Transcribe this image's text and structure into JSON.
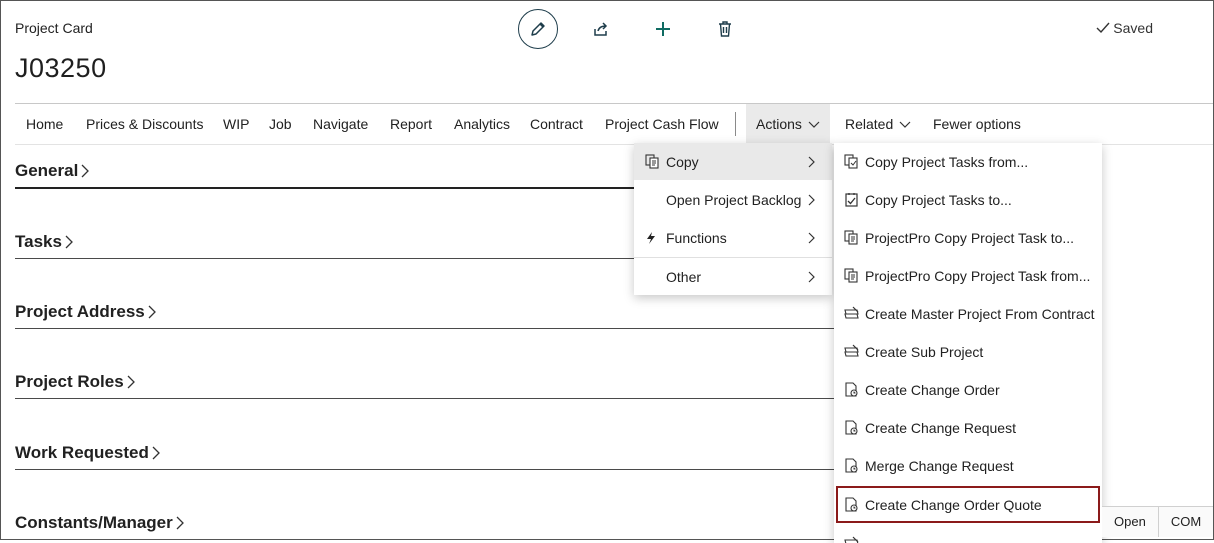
{
  "header": {
    "caption": "Project Card",
    "record_no": "J03250",
    "status": "Saved",
    "icons": [
      "edit-icon",
      "share-icon",
      "add-icon",
      "delete-icon"
    ]
  },
  "actionbar": {
    "items": [
      "Home",
      "Prices & Discounts",
      "WIP",
      "Job",
      "Navigate",
      "Report",
      "Analytics",
      "Contract",
      "Project Cash Flow"
    ],
    "actions_label": "Actions",
    "related_label": "Related",
    "fewer_label": "Fewer options"
  },
  "sections": [
    "General",
    "Tasks",
    "Project Address",
    "Project Roles",
    "Work Requested",
    "Constants/Manager"
  ],
  "actions_menu": {
    "items": [
      {
        "label": "Copy",
        "icon": "copy-icon"
      },
      {
        "label": "Open Project Backlog",
        "icon": ""
      },
      {
        "label": "Functions",
        "icon": "lightning-icon"
      },
      {
        "label": "Other",
        "icon": ""
      }
    ]
  },
  "copy_submenu": {
    "items": [
      {
        "label": "Copy Project Tasks from...",
        "icon": "copy-from-icon"
      },
      {
        "label": "Copy Project Tasks to...",
        "icon": "copy-to-icon"
      },
      {
        "label": "ProjectPro Copy Project Task to...",
        "icon": "copy-icon"
      },
      {
        "label": "ProjectPro Copy Project Task from...",
        "icon": "copy-icon"
      },
      {
        "label": "Create Master Project From Contract",
        "icon": "create-project-icon"
      },
      {
        "label": "Create Sub Project",
        "icon": "create-project-icon"
      },
      {
        "label": "Create Change Order",
        "icon": "document-icon"
      },
      {
        "label": "Create Change Request",
        "icon": "document-icon"
      },
      {
        "label": "Merge Change Request",
        "icon": "document-icon"
      },
      {
        "label": "Create Change Order Quote",
        "icon": "document-icon"
      }
    ]
  },
  "footer_tabs": [
    "Open",
    "COM"
  ],
  "colors": {
    "focus_outline": "#8b1a1a",
    "icon_dark": "#1e3d4b",
    "menu_highlight": "#e9e9e9"
  }
}
